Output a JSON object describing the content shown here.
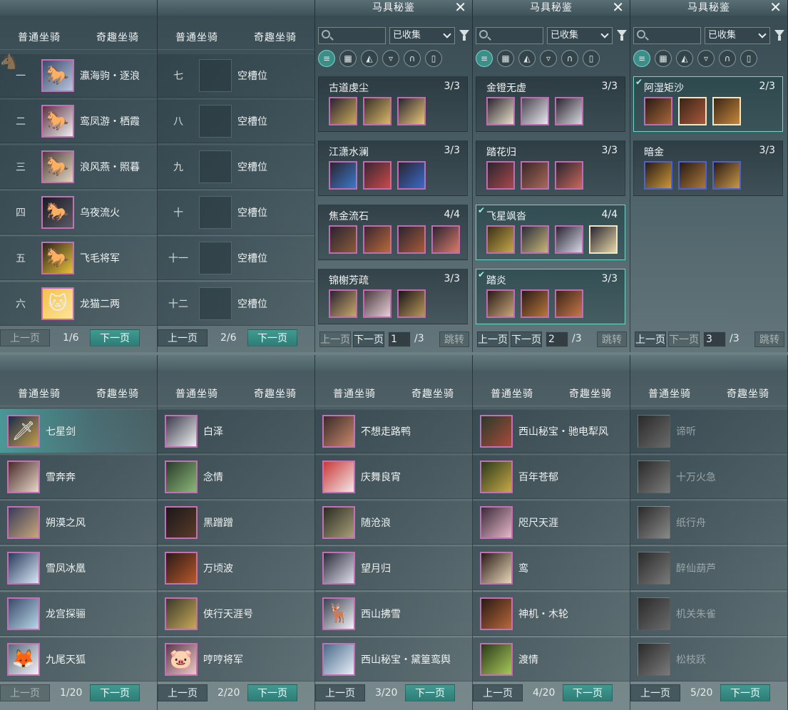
{
  "tabs": {
    "normal": "普通坐骑",
    "fun": "奇趣坐骑"
  },
  "pager": {
    "prev": "上一页",
    "next": "下一页",
    "jump": "跳转"
  },
  "top_left": {
    "rows": [
      {
        "num": "一",
        "name": "瀛海驹・逐浪"
      },
      {
        "num": "二",
        "name": "鸾凤游・栖霞"
      },
      {
        "num": "三",
        "name": "浪风燕・照暮"
      },
      {
        "num": "四",
        "name": "乌夜流火"
      },
      {
        "num": "五",
        "name": "飞毛将军"
      },
      {
        "num": "六",
        "name": "龙猫二两"
      }
    ],
    "page": "1/6"
  },
  "top_second": {
    "rows": [
      {
        "num": "七",
        "name": "空槽位"
      },
      {
        "num": "八",
        "name": "空槽位"
      },
      {
        "num": "九",
        "name": "空槽位"
      },
      {
        "num": "十",
        "name": "空槽位"
      },
      {
        "num": "十一",
        "name": "空槽位"
      },
      {
        "num": "十二",
        "name": "空槽位"
      }
    ],
    "page": "2/6"
  },
  "codex": {
    "title": "马具秘鉴",
    "filter": "已收集",
    "total": "/3",
    "pages": [
      {
        "page": "1",
        "sets": [
          {
            "name": "古道虔尘",
            "count": "3/3",
            "done": false,
            "items": 3
          },
          {
            "name": "江潇水澜",
            "count": "3/3",
            "done": false,
            "items": 3
          },
          {
            "name": "焦金流石",
            "count": "4/4",
            "done": false,
            "items": 4
          },
          {
            "name": "锦榭芳疏",
            "count": "3/3",
            "done": false,
            "items": 3
          }
        ]
      },
      {
        "page": "2",
        "sets": [
          {
            "name": "金镫无虚",
            "count": "3/3",
            "done": false,
            "items": 3
          },
          {
            "name": "踏花归",
            "count": "3/3",
            "done": false,
            "items": 3
          },
          {
            "name": "飞星飒沓",
            "count": "4/4",
            "done": true,
            "items": 4
          },
          {
            "name": "踏炎",
            "count": "3/3",
            "done": true,
            "items": 3
          }
        ]
      },
      {
        "page": "3",
        "sets": [
          {
            "name": "阿湿矩沙",
            "count": "2/3",
            "done": true,
            "items": 3
          },
          {
            "name": "暗金",
            "count": "3/3",
            "done": false,
            "items": 3
          }
        ]
      }
    ]
  },
  "bottom": [
    {
      "page": "1/20",
      "rows": [
        "七星剑",
        "雪奔奔",
        "朔漠之风",
        "雪凤冰凰",
        "龙宫探骊",
        "九尾天狐"
      ]
    },
    {
      "page": "2/20",
      "rows": [
        "白泽",
        "念情",
        "黑蹭蹭",
        "万顷波",
        "侠行天涯号",
        "哼哼将军"
      ]
    },
    {
      "page": "3/20",
      "rows": [
        "不想走路鸭",
        "庆舞良宵",
        "随沧浪",
        "望月归",
        "西山拂雪",
        "西山秘宝・黛篁鸾舆"
      ]
    },
    {
      "page": "4/20",
      "rows": [
        "西山秘宝・驰电犁风",
        "百年苍郁",
        "咫尺天涯",
        "鸾",
        "神机・木轮",
        "渡情"
      ]
    },
    {
      "page": "5/20",
      "rows": [
        "谛听",
        "十万火急",
        "纸行舟",
        "醉仙葫芦",
        "机关朱雀",
        "松枝跃"
      ]
    }
  ]
}
